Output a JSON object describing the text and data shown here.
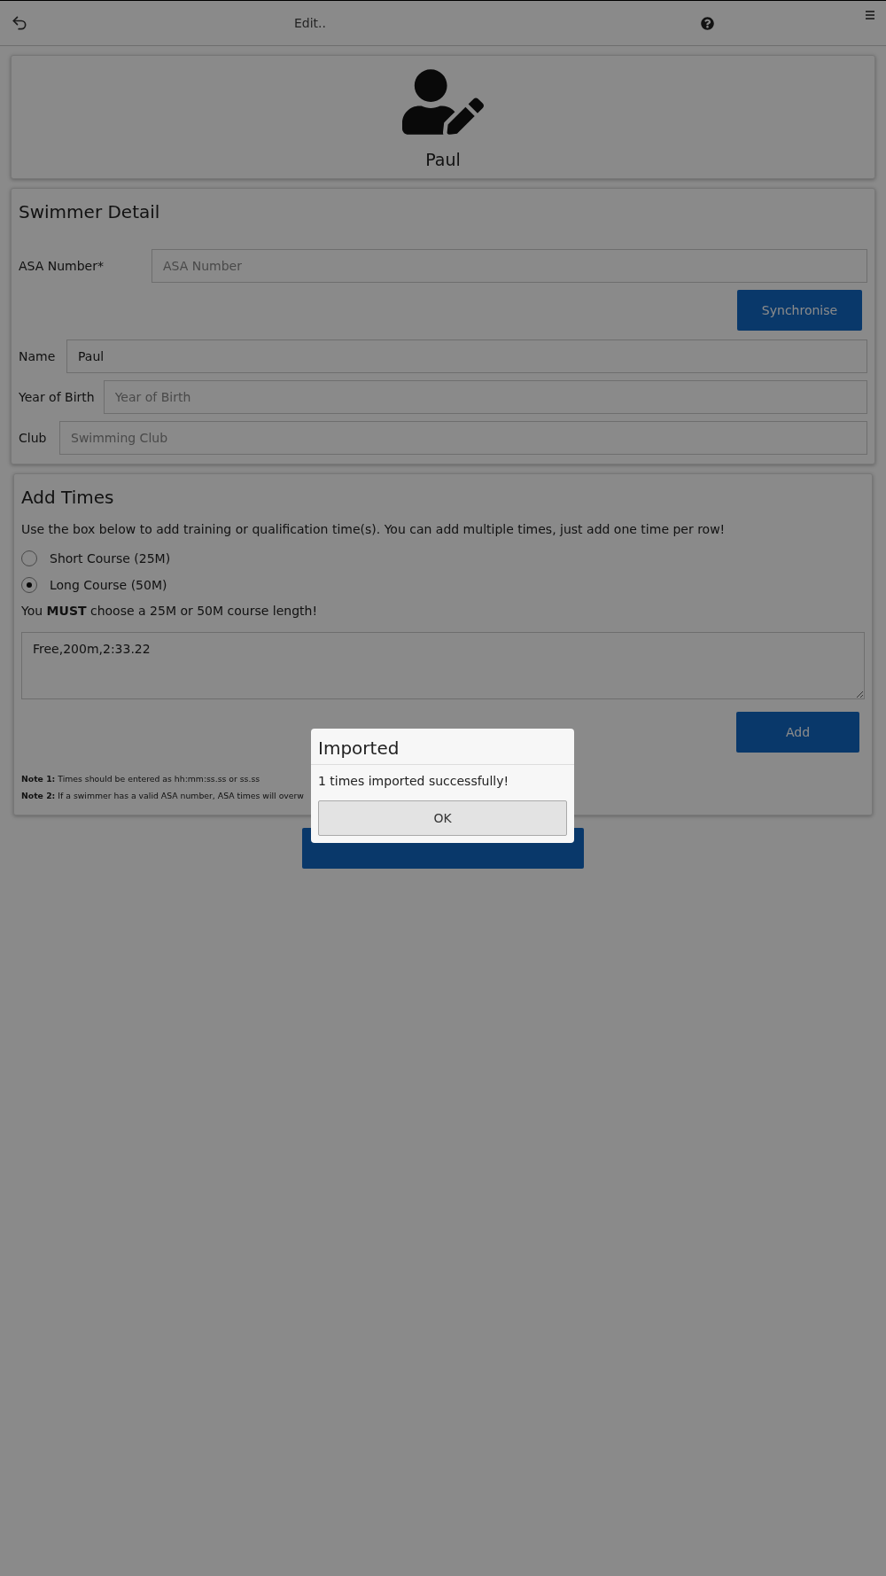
{
  "top_bar": {
    "title": "Edit.."
  },
  "profile": {
    "name": "Paul"
  },
  "swimmer_detail": {
    "title": "Swimmer Detail",
    "asa": {
      "label": "ASA Number*",
      "placeholder": "ASA Number"
    },
    "sync_button": "Synchronise",
    "fields": [
      {
        "label": "Name",
        "value": "Paul"
      },
      {
        "label": "Year of Birth",
        "placeholder": "Year of Birth"
      },
      {
        "label": "Club",
        "placeholder": "Swimming Club"
      }
    ]
  },
  "add_times": {
    "title": "Add Times",
    "description": "Use the box below to add training or qualification time(s). You can add multiple times, just add one time per row!",
    "course_options": [
      {
        "label": "Short Course (25M)",
        "selected": false
      },
      {
        "label": "Long Course (50M)",
        "selected": true
      }
    ],
    "warning": "You **MUST** choose a 25M or 50M course length!",
    "times_value": "Free,200m,2:33.22",
    "add_button": "Add",
    "notes": [
      "**Note 1:** Times should be entered as hh:mm:ss.ss or ss.ss",
      "**Note 2:** If a swimmer has a valid ASA number, ASA times will overw"
    ]
  },
  "dialog": {
    "title": "Imported",
    "message": "1 times imported successfully!",
    "button": "OK"
  }
}
